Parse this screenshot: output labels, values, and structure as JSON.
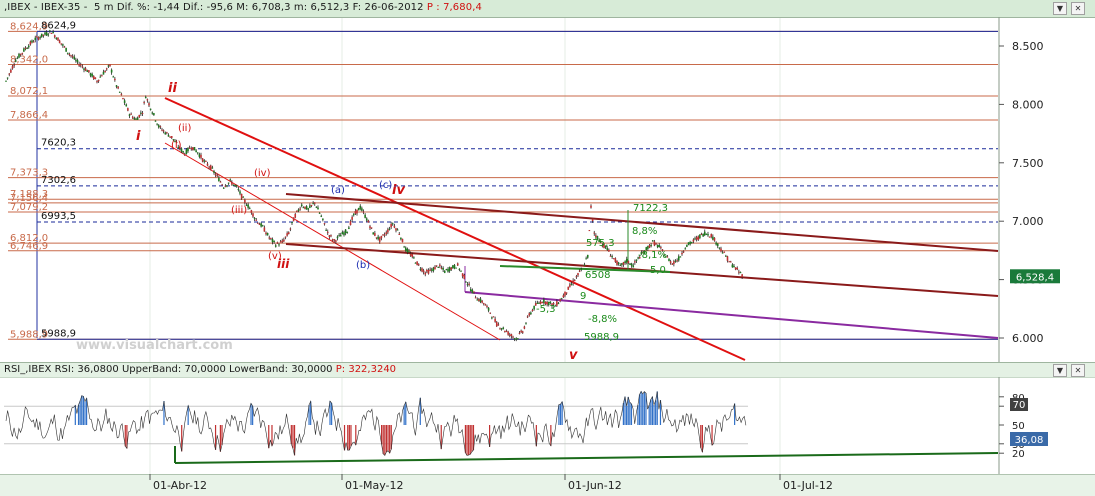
{
  "header": {
    "symbol": ",IBEX - IBEX-35 -  5 m",
    "dif_label": "Dif. %:",
    "dif_pct": "-1,44",
    "dif_abs_label": "Dif.:",
    "dif_abs": "-95,6",
    "m_label": "M:",
    "m_value": "6,708,3",
    "min_label": "m:",
    "min_value": "6,512,3",
    "f_label": "F:",
    "date": "26-06-2012",
    "p_label": "P :",
    "p_value": "7,680,4"
  },
  "rsi_header": {
    "label": "RSI_,IBEX RSI:",
    "rsi": "36,0800",
    "upper_label": "UpperBand:",
    "upper": "70,0000",
    "lower_label": "LowerBand:",
    "lower": "30,0000",
    "p_label": "P:",
    "p_value": "322,3240"
  },
  "watermark": "www.visualchart.com",
  "colors": {
    "candle_up": "#1f7a1f",
    "candle_down": "#c03030",
    "fib_line": "#c86a4a",
    "trend_red": "#e01010",
    "trend_maroon": "#8a1a1a",
    "channel_purple": "#8a2aa0",
    "support_green": "#2a8a2a",
    "rsi_up": "#3070c8",
    "rsi_down": "#c03030",
    "rsi_line": "#303030",
    "last_tag_bg": "#1a7a3a"
  },
  "chart_data": [
    {
      "type": "candlestick",
      "title": "IBEX-35 5 m",
      "yaxis": {
        "ticks": [
          "8.500",
          "8.000",
          "7.500",
          "7.000",
          "6.500",
          "6.000"
        ],
        "range": [
          5900,
          8680
        ]
      },
      "xaxis": {
        "ticks": [
          "01-Abr-12",
          "01-May-12",
          "01-Jun-12",
          "01-Jul-12"
        ]
      },
      "last_value": "6,528,4",
      "fib_levels": [
        {
          "label": "8,624,9",
          "value": 8624.9
        },
        {
          "label": "8,342,0",
          "value": 8342
        },
        {
          "label": "8,072,1",
          "value": 8072.1
        },
        {
          "label": "7,866,4",
          "value": 7866.4
        },
        {
          "label": "7,373,3",
          "value": 7373.3
        },
        {
          "label": "7,188,3",
          "value": 7188.3
        },
        {
          "label": "7,156,4",
          "value": 7156.4
        },
        {
          "label": "7,079,2",
          "value": 7079.2
        },
        {
          "label": "6,812,0",
          "value": 6812
        },
        {
          "label": "6,746,9",
          "value": 6746.9
        },
        {
          "label": "5,988,9",
          "value": 5988.9
        }
      ],
      "blue_dashed_levels": [
        {
          "label": "7620,3",
          "value": 7620.3
        },
        {
          "label": "7302,6",
          "value": 7302.6
        },
        {
          "label": "6993,5",
          "value": 6993.5
        }
      ],
      "blue_solid_levels": [
        {
          "label": "8624,9",
          "value": 8624.9
        },
        {
          "label": "5988,9",
          "value": 5988.9
        }
      ],
      "wave_labels": [
        {
          "text": "ii",
          "style": "red-bold"
        },
        {
          "text": "i",
          "style": "red-bold"
        },
        {
          "text": "(ii)",
          "style": "red"
        },
        {
          "text": "(i)",
          "style": "red"
        },
        {
          "text": "(iv)",
          "style": "red"
        },
        {
          "text": "(iii)",
          "style": "red"
        },
        {
          "text": "(v)",
          "style": "red"
        },
        {
          "text": "iii",
          "style": "red-bold"
        },
        {
          "text": "(a)",
          "style": "blue"
        },
        {
          "text": "(c)",
          "style": "blue"
        },
        {
          "text": "iv",
          "style": "red-bold"
        },
        {
          "text": "(b)",
          "style": "blue"
        },
        {
          "text": "v",
          "style": "red-bold"
        }
      ],
      "annotations": [
        {
          "text": "7122,3",
          "style": "green"
        },
        {
          "text": "575,3",
          "style": "green"
        },
        {
          "text": "8,8%",
          "style": "green"
        },
        {
          "text": "-8,1%",
          "style": "green"
        },
        {
          "text": "6508",
          "style": "green"
        },
        {
          "text": "5,0",
          "style": "green"
        },
        {
          "text": "-5,3",
          "style": "green"
        },
        {
          "text": "-8,8%",
          "style": "green"
        },
        {
          "text": "5988,9",
          "style": "green"
        },
        {
          "text": "9",
          "style": "green"
        }
      ],
      "price_path": [
        [
          0,
          8200
        ],
        [
          6,
          8380
        ],
        [
          12,
          8480
        ],
        [
          18,
          8560
        ],
        [
          24,
          8600
        ],
        [
          28,
          8625
        ],
        [
          32,
          8560
        ],
        [
          38,
          8450
        ],
        [
          44,
          8360
        ],
        [
          50,
          8290
        ],
        [
          56,
          8200
        ],
        [
          60,
          8270
        ],
        [
          64,
          8330
        ],
        [
          68,
          8160
        ],
        [
          72,
          8050
        ],
        [
          76,
          7920
        ],
        [
          80,
          7870
        ],
        [
          84,
          7940
        ],
        [
          86,
          8072
        ],
        [
          90,
          7940
        ],
        [
          94,
          7810
        ],
        [
          98,
          7760
        ],
        [
          102,
          7720
        ],
        [
          106,
          7640
        ],
        [
          110,
          7580
        ],
        [
          114,
          7640
        ],
        [
          118,
          7590
        ],
        [
          122,
          7510
        ],
        [
          126,
          7460
        ],
        [
          130,
          7380
        ],
        [
          134,
          7300
        ],
        [
          138,
          7340
        ],
        [
          142,
          7290
        ],
        [
          146,
          7190
        ],
        [
          150,
          7110
        ],
        [
          154,
          7010
        ],
        [
          158,
          6950
        ],
        [
          162,
          6860
        ],
        [
          166,
          6800
        ],
        [
          170,
          6820
        ],
        [
          174,
          6900
        ],
        [
          178,
          7050
        ],
        [
          182,
          7140
        ],
        [
          186,
          7100
        ],
        [
          190,
          7160
        ],
        [
          194,
          7040
        ],
        [
          198,
          6900
        ],
        [
          202,
          6830
        ],
        [
          206,
          6880
        ],
        [
          210,
          6920
        ],
        [
          214,
          7050
        ],
        [
          218,
          7120
        ],
        [
          222,
          7020
        ],
        [
          226,
          6900
        ],
        [
          230,
          6840
        ],
        [
          234,
          6900
        ],
        [
          238,
          6980
        ],
        [
          242,
          6900
        ],
        [
          246,
          6760
        ],
        [
          250,
          6700
        ],
        [
          254,
          6620
        ],
        [
          258,
          6560
        ],
        [
          262,
          6580
        ],
        [
          266,
          6620
        ],
        [
          270,
          6570
        ],
        [
          274,
          6600
        ],
        [
          278,
          6620
        ],
        [
          282,
          6520
        ],
        [
          286,
          6420
        ],
        [
          290,
          6340
        ],
        [
          294,
          6300
        ],
        [
          298,
          6220
        ],
        [
          302,
          6120
        ],
        [
          306,
          6080
        ],
        [
          310,
          6030
        ],
        [
          314,
          5995
        ],
        [
          318,
          6060
        ],
        [
          322,
          6200
        ],
        [
          326,
          6280
        ],
        [
          330,
          6320
        ],
        [
          334,
          6300
        ],
        [
          338,
          6280
        ],
        [
          342,
          6340
        ],
        [
          346,
          6420
        ],
        [
          350,
          6500
        ],
        [
          354,
          6580
        ],
        [
          358,
          6700
        ],
        [
          360,
          7122
        ],
        [
          362,
          6900
        ],
        [
          366,
          6820
        ],
        [
          370,
          6760
        ],
        [
          374,
          6680
        ],
        [
          378,
          6610
        ],
        [
          382,
          6660
        ],
        [
          386,
          6620
        ],
        [
          390,
          6700
        ],
        [
          394,
          6760
        ],
        [
          398,
          6820
        ],
        [
          402,
          6780
        ],
        [
          406,
          6700
        ],
        [
          410,
          6640
        ],
        [
          414,
          6680
        ],
        [
          418,
          6780
        ],
        [
          422,
          6820
        ],
        [
          426,
          6860
        ],
        [
          430,
          6900
        ],
        [
          434,
          6880
        ],
        [
          438,
          6800
        ],
        [
          442,
          6720
        ],
        [
          446,
          6640
        ],
        [
          450,
          6580
        ],
        [
          454,
          6528
        ]
      ]
    },
    {
      "type": "line",
      "title": "RSI",
      "yaxis": {
        "ticks": [
          "80",
          "70",
          "50",
          "30",
          "20"
        ],
        "range": [
          0,
          100
        ]
      },
      "upper_band": 70,
      "lower_band": 30,
      "last_value": "36,08",
      "upper_tag": "70"
    }
  ]
}
